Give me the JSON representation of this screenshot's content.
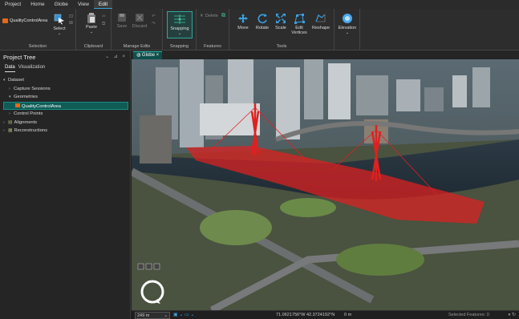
{
  "menu": {
    "items": [
      "Project",
      "Home",
      "Globe",
      "View",
      "Edit"
    ],
    "active_index": 4
  },
  "ribbon": {
    "layer_name": "QualityControlArea",
    "select_label": "Select",
    "selection_group": "Selection",
    "paste_label": "Paste",
    "clipboard_group": "Clipboard",
    "save_label": "Save",
    "discard_label": "Discard",
    "manage_group": "Manage Edits",
    "snapping_button": "Snapping",
    "snapping_group": "Snapping",
    "delete_label": "Delete",
    "features_group": "Features",
    "move_label": "Move",
    "rotate_label": "Rotate",
    "scale_label": "Scale",
    "edit_vertices_label": "Edit Vertices",
    "reshape_label": "Reshape",
    "tools_group": "Tools",
    "elevation_label": "Elevation"
  },
  "project_tree": {
    "title": "Project Tree",
    "controls": "⌄ ⊿ ×",
    "tabs": [
      "Data",
      "Visualization"
    ],
    "active_tab": 0,
    "items": [
      {
        "label": "Dataset",
        "level": 0,
        "chev": "▾"
      },
      {
        "label": "Capture Sessions",
        "level": 1,
        "chev": "›"
      },
      {
        "label": "Geometries",
        "level": 1,
        "chev": "▾"
      },
      {
        "label": "QualityControlArea",
        "level": 2,
        "chev": "",
        "selected": true
      },
      {
        "label": "Control Points",
        "level": 1,
        "chev": "›"
      },
      {
        "label": "Alignments",
        "level": 0,
        "chev": "›"
      },
      {
        "label": "Reconstructions",
        "level": 0,
        "chev": "›"
      }
    ]
  },
  "view": {
    "tab_label": "Globe",
    "tab_close": "×"
  },
  "status": {
    "scale": "249 m",
    "coordinates": "71.0621756°W 42.3724192°N",
    "elevation": "0 m",
    "selected_features": "Selected Features: 0"
  },
  "colors": {
    "accent": "#35a0d8",
    "selection": "#0f5c56",
    "overlay": "#e02020"
  }
}
